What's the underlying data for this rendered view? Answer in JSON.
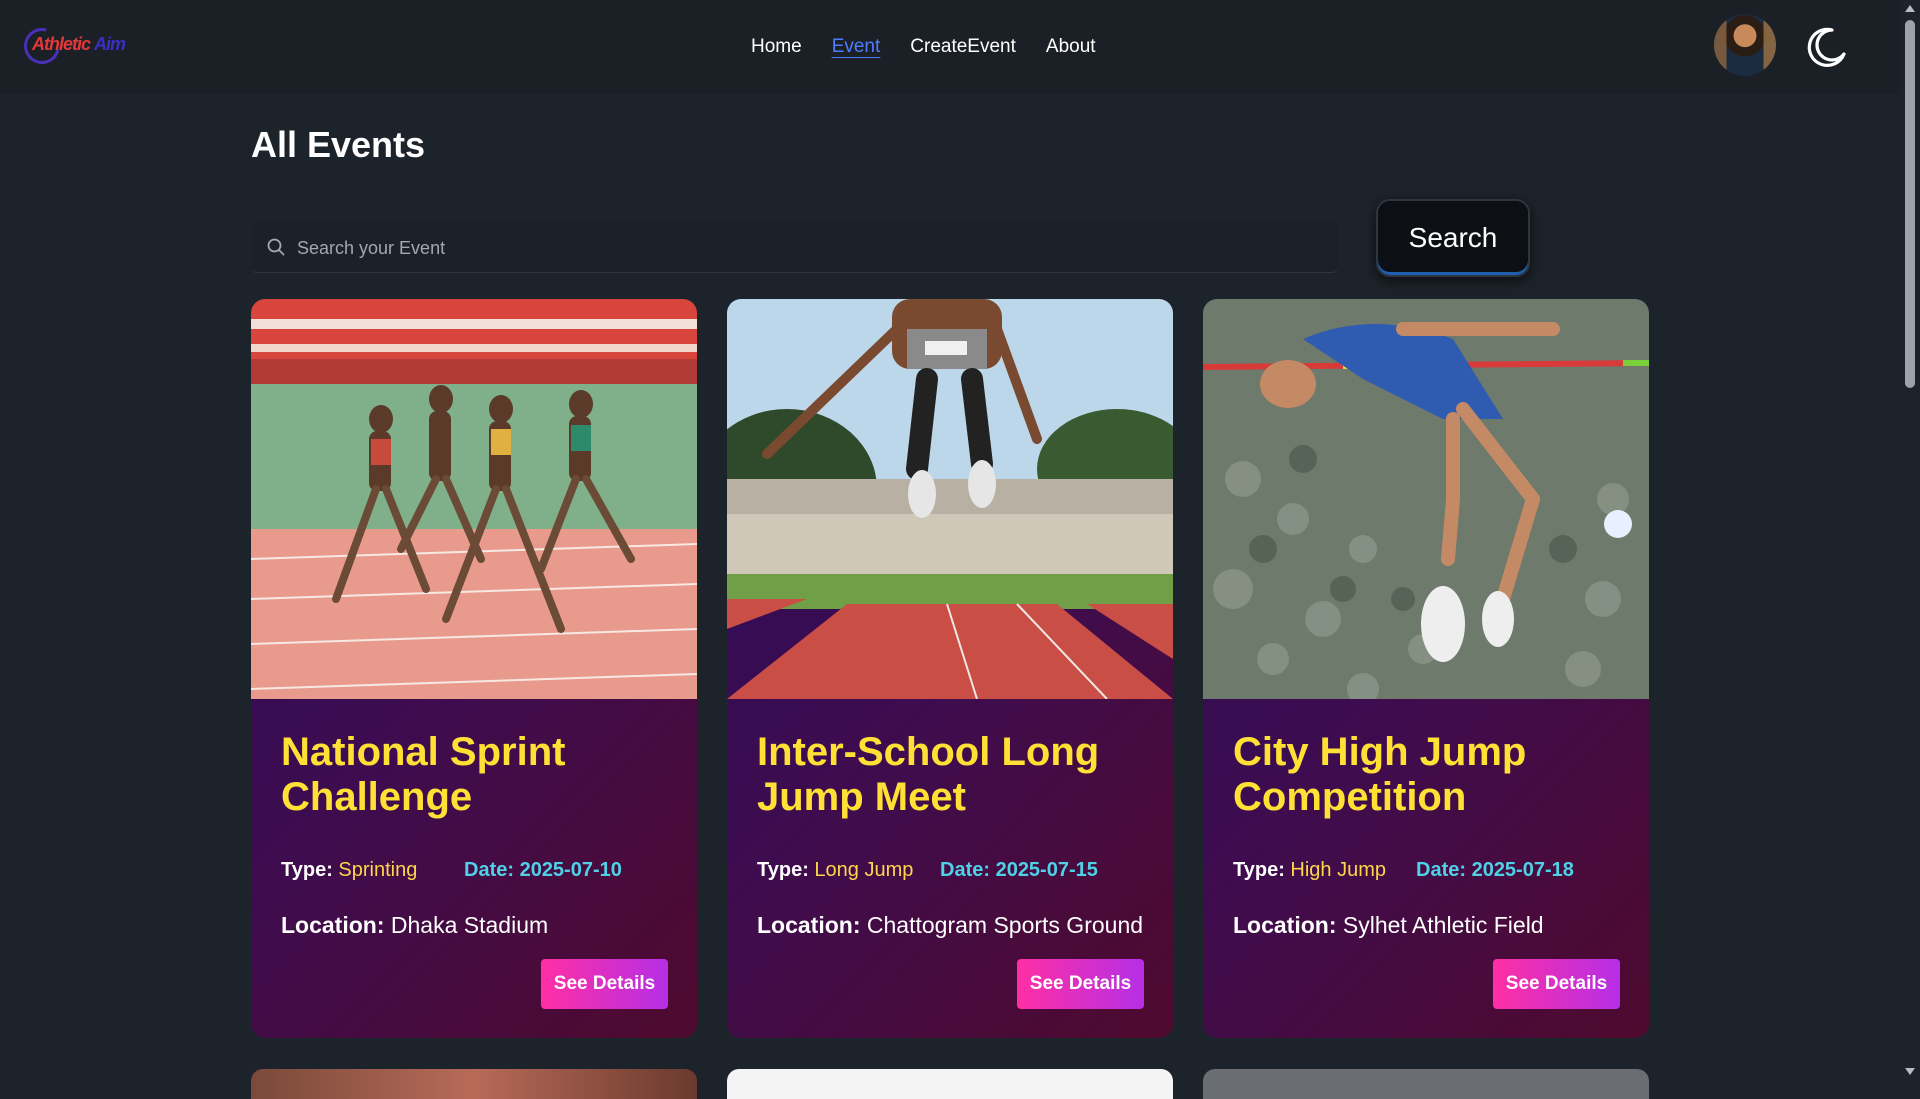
{
  "nav": {
    "logo_part1": "Athletic",
    "logo_part2": "Aim",
    "links": [
      "Home",
      "Event",
      "CreateEvent",
      "About"
    ],
    "active": "Event"
  },
  "main": {
    "title": "All Events",
    "search": {
      "placeholder": "Search your Event",
      "value": "",
      "button_label": "Search"
    }
  },
  "labels": {
    "type": "Type:",
    "location": "Location:"
  },
  "events": [
    {
      "title": "National Sprint Challenge",
      "type": "Sprinting",
      "date": "Date: 2025-07-10",
      "location": "Dhaka Stadium",
      "button": "See Details"
    },
    {
      "title": "Inter-School Long Jump Meet",
      "type": "Long Jump",
      "date": "Date: 2025-07-15",
      "location": "Chattogram Sports Ground",
      "button": "See Details"
    },
    {
      "title": "City High Jump Competition",
      "type": "High Jump",
      "date": "Date: 2025-07-18",
      "location": "Sylhet Athletic Field",
      "button": "See Details"
    }
  ],
  "colors": {
    "background": "#1d232a",
    "title_yellow": "#ffe135",
    "date_cyan": "#4fd1e8",
    "nav_active": "#4f7dff",
    "button_pink": "#ff2fa4",
    "button_purple": "#b52fe6"
  },
  "icons": [
    "search-icon",
    "moon-icon",
    "avatar"
  ]
}
